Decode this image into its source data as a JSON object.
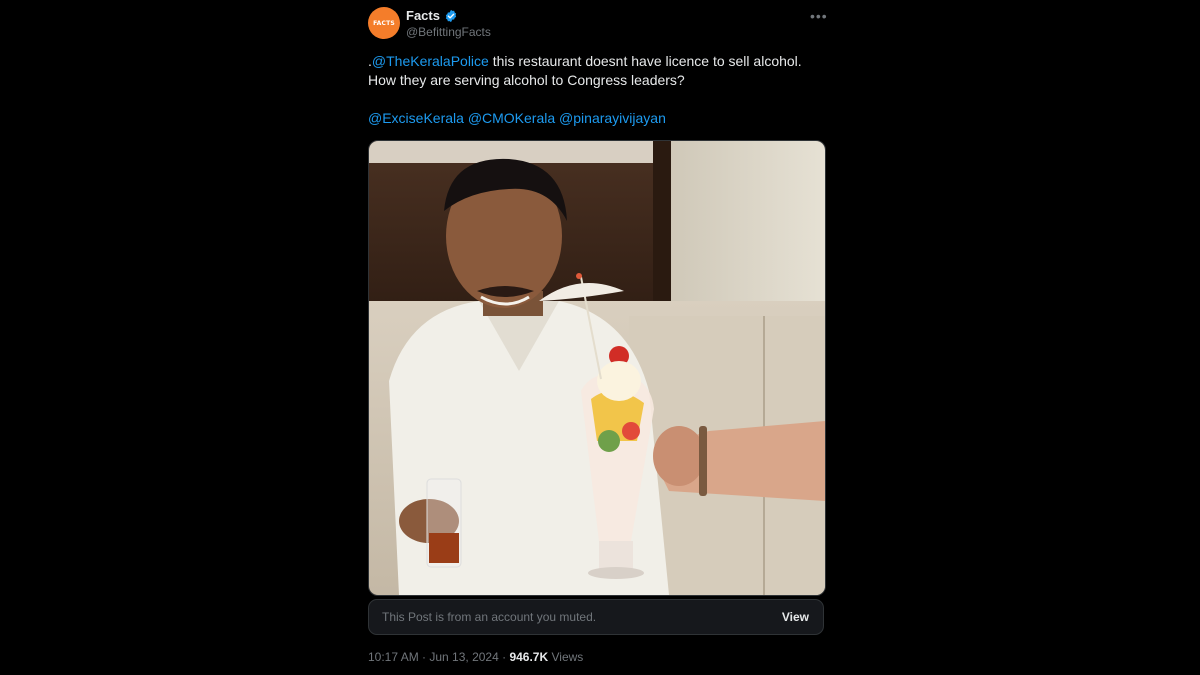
{
  "author": {
    "display_name": "Facts",
    "handle": "@BefittingFacts",
    "avatar_text": "FACTS",
    "verified_icon": "verified-badge-icon",
    "verified_color": "#1d9bf0"
  },
  "post": {
    "leading_dot": ".",
    "mention_1": "@TheKeralaPolice",
    "text_1": " this restaurant doesnt have licence to sell alcohol.",
    "text_2": "How they are serving alcohol to Congress leaders?",
    "mentions_line": [
      "@ExciseKerala",
      "@CMOKerala",
      "@pinarayivijayan"
    ]
  },
  "muted_notice": {
    "text": "This Post is from an account you muted.",
    "button": "View"
  },
  "meta": {
    "time": "10:17 AM",
    "separator": " · ",
    "date": "Jun 13, 2024",
    "views_count": "946.7K",
    "views_label": " Views"
  },
  "colors": {
    "background": "#000000",
    "text": "#e7e9ea",
    "secondary": "#71767b",
    "link": "#1d9bf0",
    "avatar": "#f47d2a"
  }
}
